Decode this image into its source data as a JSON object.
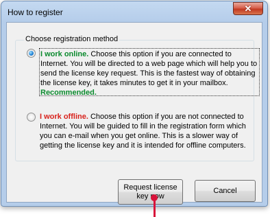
{
  "window": {
    "title": "How to register"
  },
  "group": {
    "legend": "Choose registration method"
  },
  "online": {
    "title": "I work online.",
    "body": " Choose this option if you are connected to Internet. You will be directed to a web page which will help you to send the license key request. This is the fastest way of obtaining the license key, it takes minutes to get it in your mailbox. ",
    "recommended": "Recommended.",
    "selected": true
  },
  "offline": {
    "title": "I work offline.",
    "body": " Choose this option if you are not connected to Internet. You will be guided to fill in the registration form which you can e-mail when you get online. This is a slower way of getting the license key and it is intended for offline computers.",
    "selected": false
  },
  "buttons": {
    "request": "Request license key now",
    "cancel": "Cancel"
  },
  "colors": {
    "accent_green": "#0b8a2e",
    "accent_red": "#d8221c",
    "pointer": "#d8123a",
    "close": "#c23a22"
  },
  "icons": {
    "close": "close-icon"
  }
}
